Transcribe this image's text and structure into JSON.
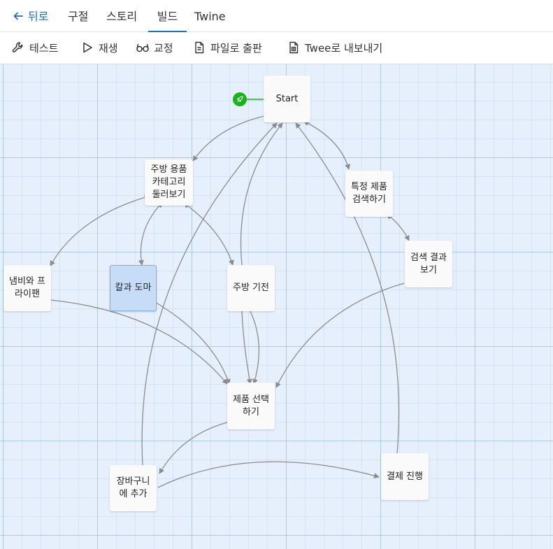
{
  "nav": {
    "back_label": "뒤로",
    "tabs": [
      {
        "label": "구절"
      },
      {
        "label": "스토리"
      },
      {
        "label": "빌드",
        "active": true
      },
      {
        "label": "Twine"
      }
    ]
  },
  "toolbar": {
    "items": [
      {
        "label": "테스트",
        "icon": "wrench-icon"
      },
      {
        "label": "재생",
        "icon": "play-icon"
      },
      {
        "label": "교정",
        "icon": "glasses-icon"
      },
      {
        "label": "파일로 출판",
        "icon": "file-icon"
      },
      {
        "label": "Twee로 내보내기",
        "icon": "file-export-icon"
      }
    ]
  },
  "passages": {
    "start": "Start",
    "kitchen_category": "주방 용품\n카테고리\n둘러보기",
    "search_product": "특정 제품\n검색하기",
    "search_results": "검색 결과\n보기",
    "pots_pans": "냄비와 프\n라이팬",
    "knife_board": "칼과 도마",
    "appliances": "주방 기전",
    "select_product": "제품 선택\n하기",
    "add_cart": "장바구니\n에 추가",
    "checkout": "결제 진행"
  },
  "colors": {
    "accent": "#1f6fc0",
    "start_marker": "#18b418",
    "selected_passage": "#c6dcf7",
    "link_line": "#8c8c8c"
  },
  "icons": {
    "start_marker": "rocket-icon"
  }
}
